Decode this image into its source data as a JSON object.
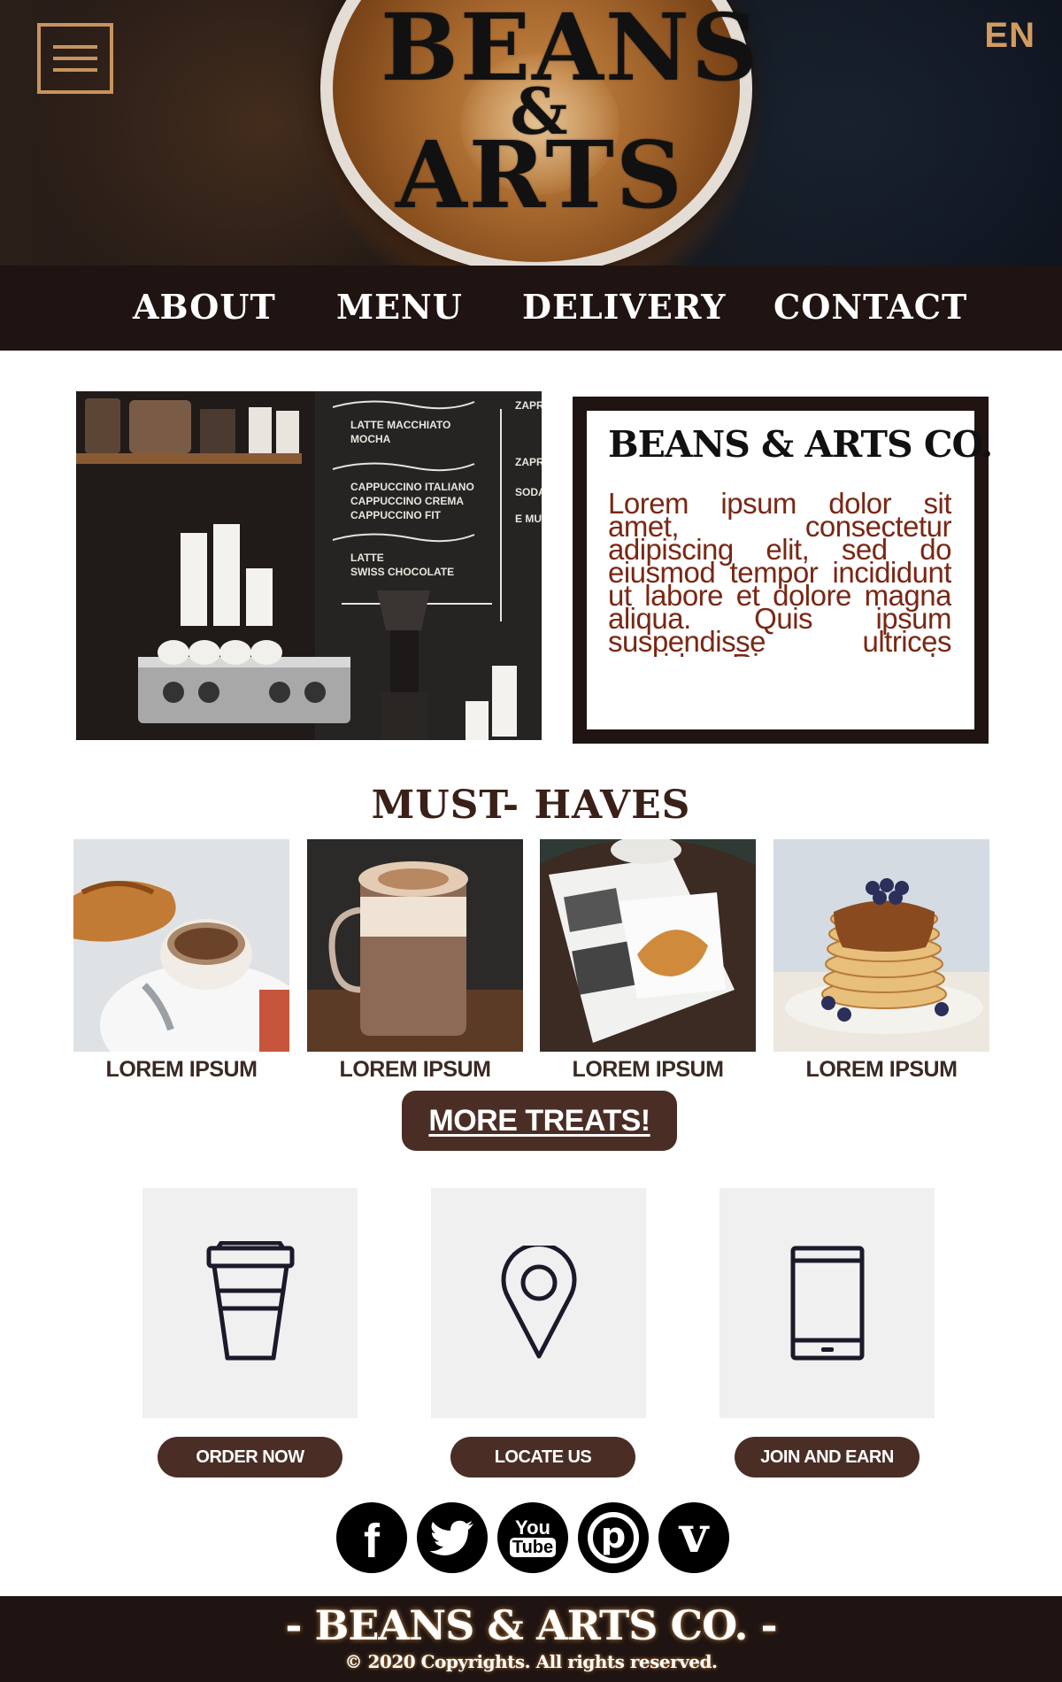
{
  "header": {
    "logo_line1": "BEANS",
    "logo_amp": "&",
    "logo_line2": "ARTS",
    "language": "EN",
    "menu_icon": "hamburger-menu-icon"
  },
  "nav": {
    "items": [
      {
        "label": "ABOUT"
      },
      {
        "label": "MENU"
      },
      {
        "label": "DELIVERY"
      },
      {
        "label": "CONTACT"
      }
    ]
  },
  "about": {
    "photo_icon": "cafe-counter-photo",
    "title": "BEANS & ARTS CO.",
    "text": "Lorem ipsum dolor sit amet, consectetur adipiscing elit, sed do eiusmod tempor incididunt ut labore et dolore magna aliqua. Quis ipsum suspendisse ultrices gravida. Risus commodo viverra maecenas accumsan lacus vel"
  },
  "must_haves": {
    "title": "MUST- HAVES",
    "items": [
      {
        "caption": "LOREM IPSUM",
        "image": "croissant-cappuccino-photo"
      },
      {
        "caption": "LOREM IPSUM",
        "image": "hot-chocolate-mug-photo"
      },
      {
        "caption": "LOREM IPSUM",
        "image": "croissant-newspaper-photo"
      },
      {
        "caption": "LOREM IPSUM",
        "image": "pancake-stack-photo"
      }
    ],
    "more_button": "MORE TREATS!"
  },
  "actions": [
    {
      "label": "ORDER NOW",
      "icon": "coffee-cup-icon"
    },
    {
      "label": "LOCATE US",
      "icon": "map-pin-icon"
    },
    {
      "label": "JOIN AND EARN",
      "icon": "smartphone-icon"
    }
  ],
  "social": [
    {
      "icon": "facebook-icon",
      "glyph": "f"
    },
    {
      "icon": "twitter-icon",
      "glyph": ""
    },
    {
      "icon": "youtube-icon",
      "glyph_top": "You",
      "glyph_bottom": "Tube"
    },
    {
      "icon": "pinterest-icon",
      "glyph": "p"
    },
    {
      "icon": "vine-icon",
      "glyph": "v"
    }
  ],
  "footer": {
    "brand": "- BEANS & ARTS CO. -",
    "copyright": "© 2020 Copyrights. All rights reserved."
  },
  "colors": {
    "dark_brown": "#1f1412",
    "button_brown": "#4a2e26",
    "accent_gold": "#c8935c",
    "text_rust": "#7a2714"
  }
}
